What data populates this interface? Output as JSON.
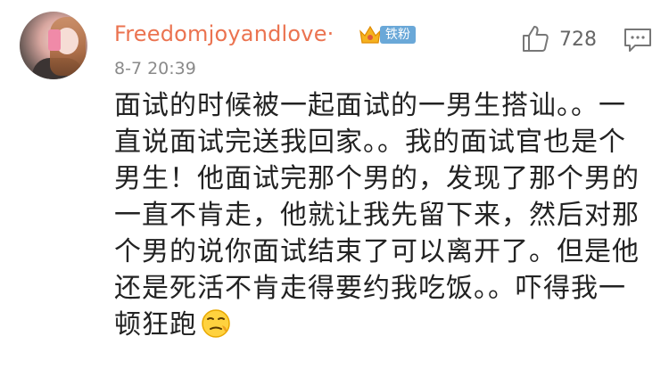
{
  "comment": {
    "username": "Freedomjoyandlove·",
    "badge_label": "铁粉",
    "timestamp": "8-7 20:39",
    "like_count": "728",
    "content_lines": [
      "面试的时候被一起面试的一男生搭讪。。一",
      "直说面试完送我回家。。我的面试官也是个",
      "男生！他面试完那个男的，发现了那个男的",
      "一直不肯走，他就让我先留下来，然后对那",
      "个男的说你面试结束了可以离开了。但是他",
      "还是死活不肯走得要约我吃饭。。吓得我一",
      "顿狂跑"
    ]
  },
  "icons": {
    "like": "thumbs-up-icon",
    "reply": "comment-icon",
    "badge": "crown-icon",
    "emoji": "awkward-face-emoji"
  },
  "colors": {
    "username": "#eb7350",
    "badge": "#6aa8d8",
    "timestamp": "#8a8a8a",
    "text": "#222222"
  }
}
